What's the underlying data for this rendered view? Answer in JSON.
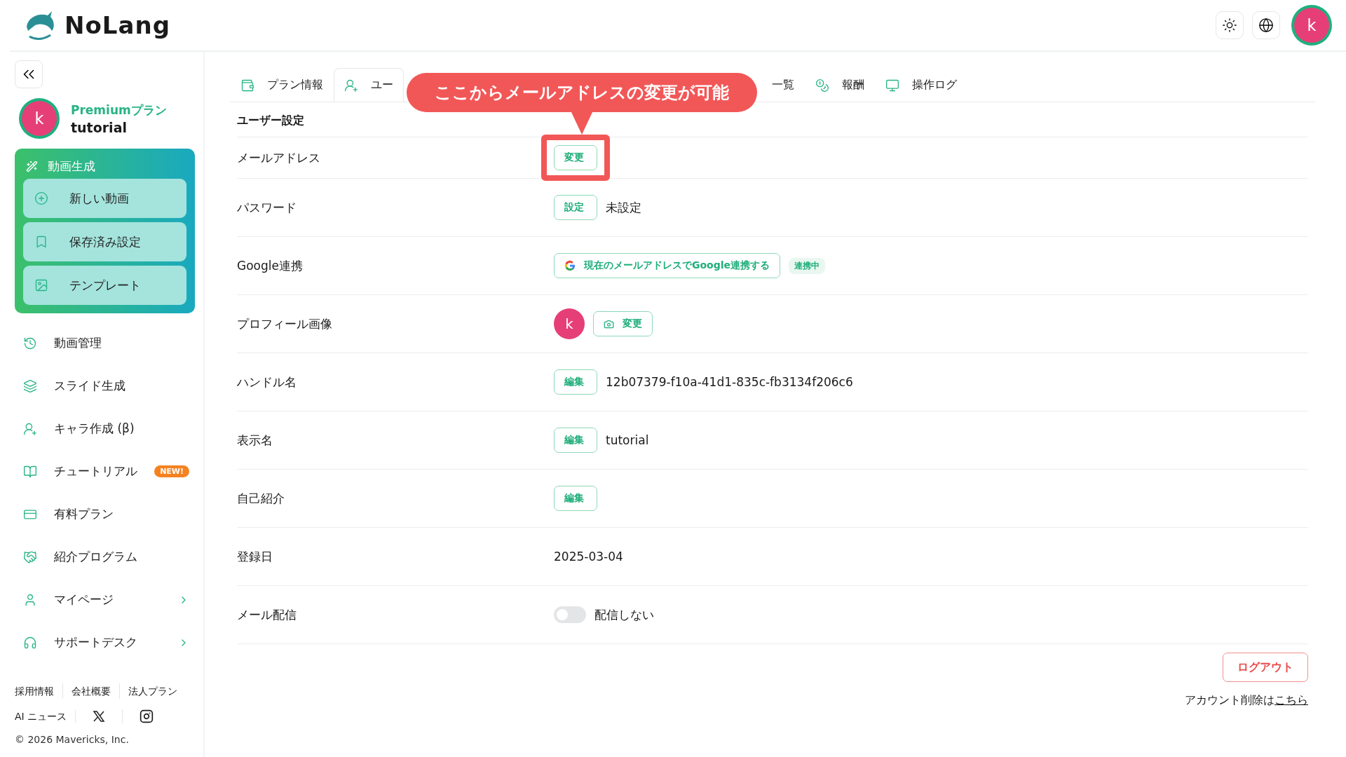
{
  "header": {
    "logo": "NoLang"
  },
  "sidebar": {
    "plan": "Premiumプラン",
    "user": "tutorial",
    "avatar_letter": "k",
    "create_group": {
      "title": "動画生成",
      "items": [
        {
          "label": "新しい動画"
        },
        {
          "label": "保存済み設定"
        },
        {
          "label": "テンプレート"
        }
      ]
    },
    "items": [
      {
        "label": "動画管理",
        "has_submenu": false
      },
      {
        "label": "スライド生成",
        "has_submenu": false
      },
      {
        "label": "キャラ作成 (β)",
        "has_submenu": false
      },
      {
        "label": "チュートリアル",
        "badge": "NEW!",
        "has_submenu": false
      },
      {
        "label": "有料プラン",
        "has_submenu": false
      },
      {
        "label": "紹介プログラム",
        "has_submenu": false
      },
      {
        "label": "マイページ",
        "has_submenu": true
      },
      {
        "label": "サポートデスク",
        "has_submenu": true
      }
    ],
    "footer_links": [
      "採用情報",
      "会社概要",
      "法人プラン"
    ],
    "news_link": "AI ニュース",
    "copyright": "© 2026 Mavericks, Inc."
  },
  "tabs": [
    {
      "label": "プラン情報",
      "selected": false
    },
    {
      "label": "ユー",
      "selected": true
    },
    {
      "label": "一覧",
      "selected": false
    },
    {
      "label": "報酬",
      "selected": false
    },
    {
      "label": "操作ログ",
      "selected": false
    }
  ],
  "callout": "ここからメールアドレスの変更が可能",
  "section_title": "ユーザー設定",
  "rows": [
    {
      "kind": "button",
      "label": "メールアドレス",
      "button": "変更",
      "highlighted": true
    },
    {
      "kind": "button",
      "label": "パスワード",
      "button": "設定",
      "value": "未設定",
      "highlighted": false
    },
    {
      "kind": "google",
      "label": "Google連携",
      "button": "現在のメールアドレスでGoogle連携する",
      "status": "連携中"
    },
    {
      "kind": "avatar",
      "label": "プロフィール画像",
      "avatar_letter": "k",
      "button": "変更"
    },
    {
      "kind": "button",
      "label": "ハンドル名",
      "button": "編集",
      "value": "12b07379-f10a-41d1-835c-fb3134f206c6",
      "highlighted": false
    },
    {
      "kind": "button",
      "label": "表示名",
      "button": "編集",
      "value": "tutorial",
      "highlighted": false
    },
    {
      "kind": "button",
      "label": "自己紹介",
      "button": "編集",
      "highlighted": false
    },
    {
      "kind": "text",
      "label": "登録日",
      "value": "2025-03-04"
    },
    {
      "kind": "toggle",
      "label": "メール配信",
      "on": false,
      "value": "配信しない"
    }
  ],
  "logout": "ログアウト",
  "delete_note": {
    "text": "アカウント削除は",
    "link": "こちら"
  },
  "header_avatar_letter": "k"
}
